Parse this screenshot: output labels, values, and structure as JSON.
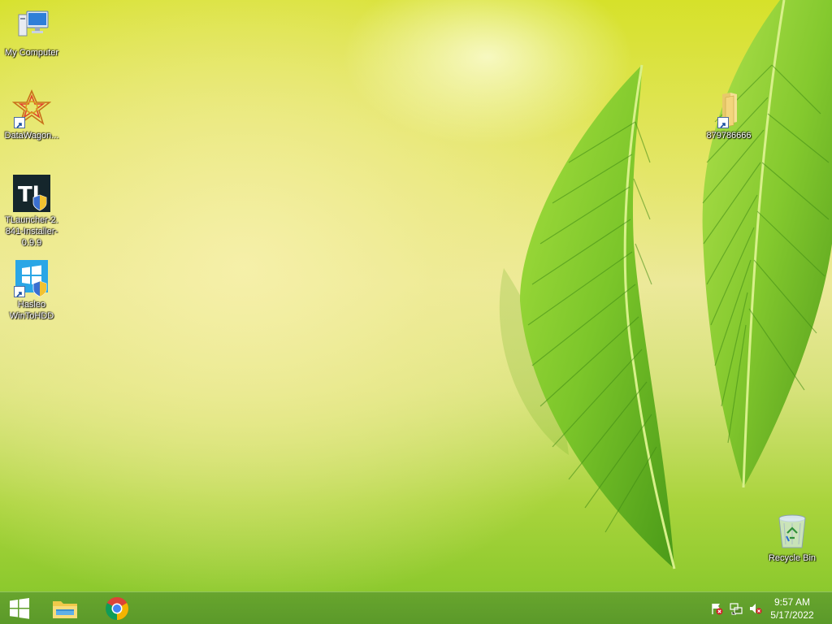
{
  "desktop": {
    "icons": [
      {
        "label": "My Computer",
        "icon": "computer-icon"
      },
      {
        "label": "DataWagon...",
        "icon": "datawagon-icon"
      },
      {
        "label": "TLauncher-2.841-Installer-0.9.9",
        "line1": "TLauncher-2.",
        "line2": "841-Installer-",
        "line3": "0.9.9",
        "icon": "tlauncher-icon"
      },
      {
        "label": "Hasleo WinToHDD",
        "line1": "Hasleo",
        "line2": "WinToHDD",
        "icon": "wintohdd-icon"
      },
      {
        "label": "879786666",
        "icon": "folder-icon"
      },
      {
        "label": "Recycle Bin",
        "icon": "recycle-bin-icon"
      }
    ]
  },
  "taskbar": {
    "start": {
      "icon": "windows-start-icon"
    },
    "pinned": [
      {
        "icon": "file-explorer-icon"
      },
      {
        "icon": "chrome-icon"
      }
    ],
    "tray": [
      {
        "icon": "action-center-flag-icon"
      },
      {
        "icon": "network-icon"
      },
      {
        "icon": "volume-muted-icon"
      }
    ],
    "clock": {
      "time": "9:57 AM",
      "date": "5/17/2022"
    }
  },
  "colors": {
    "taskbar": "#5fa02d",
    "leaf": "#7cc62a",
    "leaf_dark": "#3f8a14"
  }
}
